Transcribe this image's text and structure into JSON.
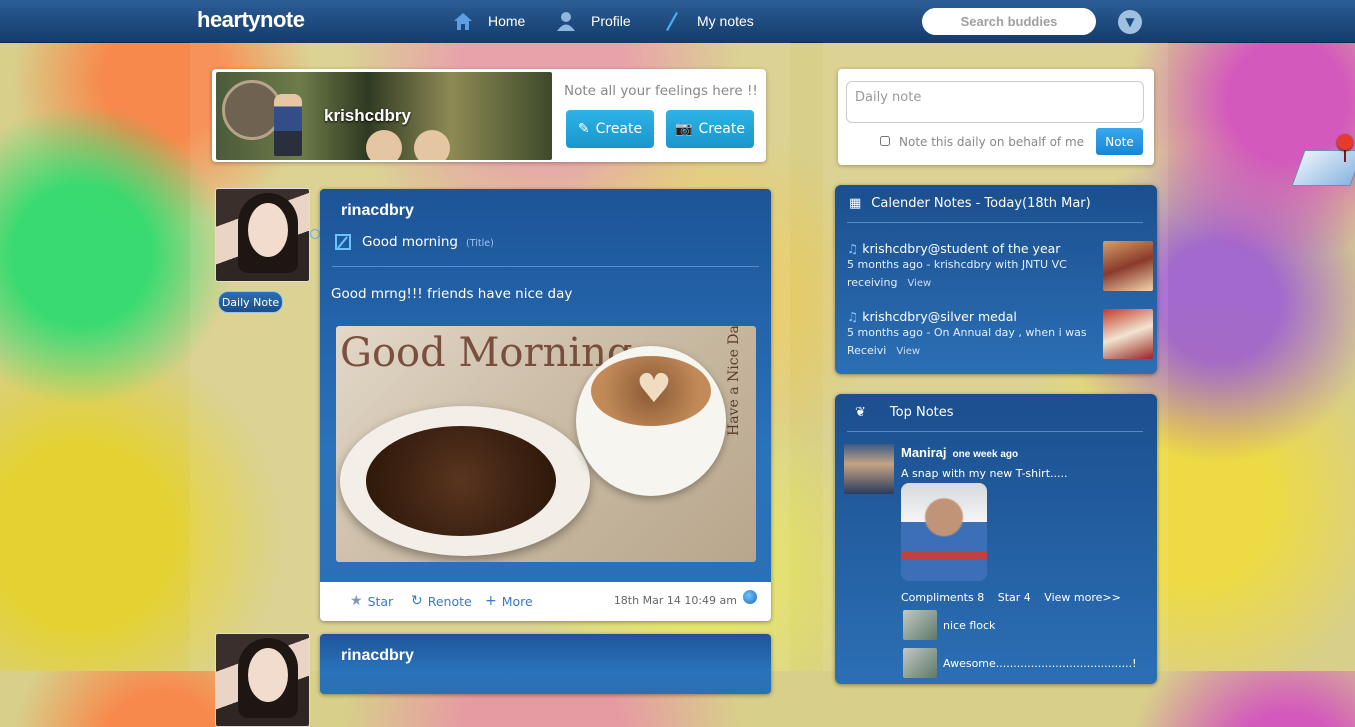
{
  "app": {
    "logo": "heartynote"
  },
  "nav": {
    "home": "Home",
    "profile": "Profile",
    "my_notes": "My notes",
    "search_placeholder": "Search buddies"
  },
  "create": {
    "username": "krishcdbry",
    "prompt": "Note all your feelings here !!",
    "create_text_label": "Create",
    "create_photo_label": "Create"
  },
  "posts": [
    {
      "user": "rinacdbry",
      "badge": "Daily Note",
      "title": "Good morning",
      "title_hint": "(Title)",
      "body": "Good mrng!!! friends have nice day",
      "image_caption": "Good Morning",
      "image_sub": "Have a Nice Day",
      "actions": {
        "star": "Star",
        "renote": "Renote",
        "more": "More"
      },
      "timestamp": "18th Mar 14 10:49 am"
    },
    {
      "user": "rinacdbry"
    }
  ],
  "daily_note": {
    "placeholder": "Daily note",
    "checkbox_label": "Note this daily on behalf of me",
    "button": "Note"
  },
  "calendar": {
    "heading": "Calender Notes - Today(18th  Mar)",
    "items": [
      {
        "title": "krishcdbry@student of the year",
        "desc": "5 months ago - krishcdbry with JNTU VC receiving",
        "view": "View"
      },
      {
        "title": "krishcdbry@silver medal",
        "desc": "5 months ago - On Annual day , when i was Receivi",
        "view": "View"
      }
    ]
  },
  "top_notes": {
    "heading": "Top Notes",
    "user": "Maniraj",
    "time": "one week ago",
    "text": "A snap with my new T-shirt.....",
    "compliments": "Compliments 8",
    "stars": "Star 4",
    "view_more": "View more>>",
    "comments": [
      {
        "text": "nice flock"
      },
      {
        "text": "Awesome.......................................!"
      }
    ]
  },
  "colors": {
    "accent": "#2a72bb",
    "button": "#1896cc",
    "topbar": "#1d4a80"
  }
}
